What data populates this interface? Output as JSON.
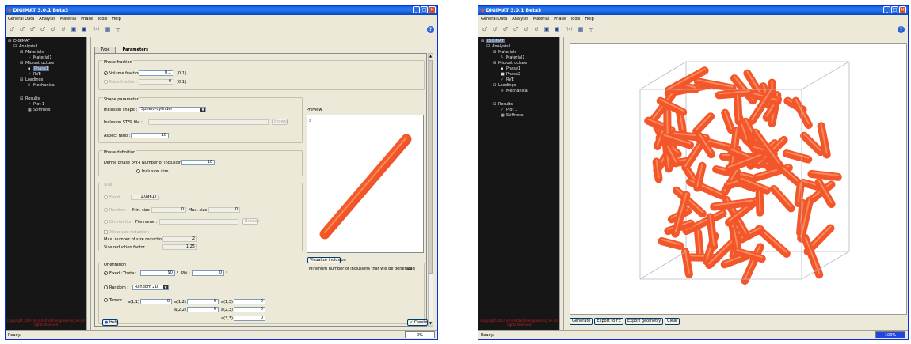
{
  "app": {
    "title": "DIGIMAT 3.0.1 Beta3",
    "menu": [
      "General Data",
      "Analysis",
      "Material",
      "Phase",
      "Tools",
      "Help"
    ],
    "toolbar_fx": "f(x)",
    "help_glyph": "?",
    "status_ready": "Ready.",
    "copyright": "Copyright 2007 (c) e-Xstream engineering SA All rights reserved"
  },
  "tree_left": {
    "root": "DIGIMAT",
    "analysis": "Analysis1",
    "materials": "Materials",
    "material1": "Material1",
    "microstructure": "Microstructure",
    "phase1": "Phase1",
    "rve": "RVE",
    "loadings": "Loadings",
    "mechanical": "Mechanical",
    "results": "Results",
    "plot1": "Plot 1",
    "stiffness": "Stiffness"
  },
  "tree_right": {
    "root": "DIGIMAT",
    "analysis": "Analysis1",
    "materials": "Materials",
    "material1": "Material1",
    "microstructure": "Microstructure",
    "phase1": "Phase1",
    "phase2": "Phase2",
    "rve": "RVE",
    "loadings": "Loadings",
    "mechanical": "Mechanical",
    "results": "Results",
    "plot1": "Plot 1",
    "stiffness": "Stiffness"
  },
  "form": {
    "tabs": [
      "Type",
      "Parameters"
    ],
    "phase_fraction": {
      "title": "Phase fraction",
      "volume_label": "Volume fraction :",
      "volume_value": "0.1",
      "volume_range": "[0,1]",
      "mass_label": "Mass fraction :",
      "mass_value": "0",
      "mass_range": "[0,1]"
    },
    "shape": {
      "title": "Shape parameter",
      "inclusion_shape_label": "Inclusion shape :",
      "inclusion_shape_value": "Sphero-cylinder",
      "step_file_label": "Inclusion STEP file :",
      "browse": "Browse",
      "aspect_label": "Aspect ratio :",
      "aspect_value": "10"
    },
    "phase_def": {
      "title": "Phase definition",
      "define_label": "Define phase by :",
      "number_label": "Number of inclusions :",
      "number_value": "10",
      "size_label": "Inclusion size"
    },
    "size": {
      "title": "Size",
      "fixed_label": "Fixed :",
      "fixed_value": "1.09617",
      "random_label": "Random",
      "min_label": "Min. size :",
      "min_value": "0",
      "max_label": "Max. size :",
      "max_value": "0",
      "dist_label": "Distribution",
      "file_label": "File name :",
      "browse": "Browse",
      "allow_label": "Allow size reduction",
      "maxnum_label": "Max. number of size reductions :",
      "maxnum_value": "2",
      "factor_label": "Size reduction factor :",
      "factor_value": "1.25"
    },
    "orientation": {
      "title": "Orientation",
      "fixed_label": "Fixed :",
      "theta_label": "Theta :",
      "theta_value": "90",
      "deg1": "°",
      "phi_label": "Phi :",
      "phi_value": "0",
      "deg2": "°",
      "random_label": "Random :",
      "random_value": "Random 2D",
      "tensor_label": "Tensor :",
      "a11_label": "a(1,1)",
      "a11_value": "0",
      "a12_label": "a(1,2)",
      "a12_value": "0",
      "a13_label": "a(1,3)",
      "a13_value": "0",
      "a22_label": "a(2,2)",
      "a22_value": "0",
      "a23_label": "a(2,3)",
      "a23_value": "0",
      "a33_label": "a(3,3)",
      "a33_value": "0"
    },
    "preview": {
      "title": "Preview",
      "visualize_button": "Visualize inclusion",
      "min_count_text": "Minimum number of inclusions that will be generated :",
      "min_count_value": "10"
    },
    "help_button": "Help",
    "create_button": "Create"
  },
  "status": {
    "left_progress": "0%",
    "right_progress": "100%",
    "left_progress_fraction": 0,
    "right_progress_fraction": 1
  },
  "viewer": {
    "buttons": [
      "Generate",
      "Export to FE",
      "Export geometry",
      "Clear"
    ],
    "inclusion_color": "#f2562a"
  }
}
